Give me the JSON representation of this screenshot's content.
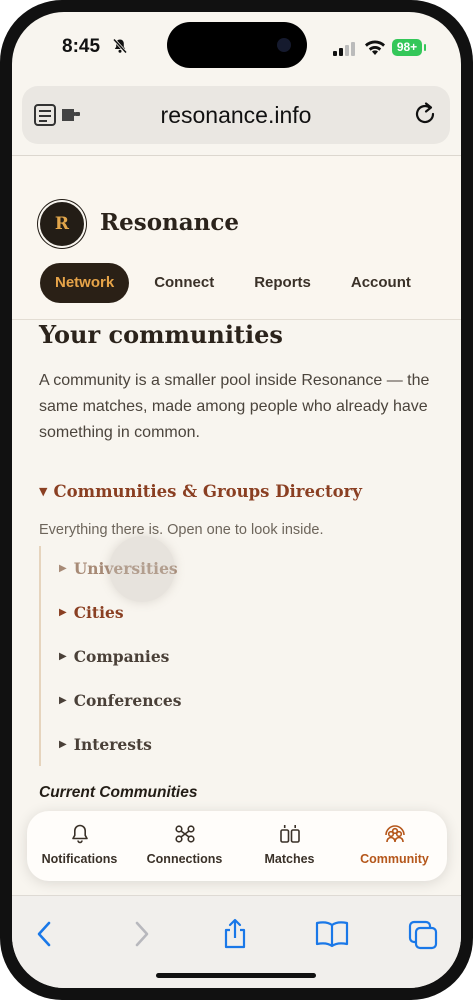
{
  "status_bar": {
    "time": "8:45",
    "battery": "98+"
  },
  "browser": {
    "url": "resonance.info"
  },
  "header": {
    "logo_letter": "R",
    "brand": "Resonance",
    "tabs": [
      "Network",
      "Connect",
      "Reports",
      "Account"
    ],
    "active_tab": "Network"
  },
  "main": {
    "title": "Your communities",
    "intro": "A community is a smaller pool inside Resonance — the same matches, made among people who already have something in common.",
    "directory": {
      "title": "Communities & Groups Directory",
      "subtitle": "Everything there is. Open one to look inside.",
      "items": [
        "Universities",
        "Cities",
        "Companies",
        "Conferences",
        "Interests"
      ]
    },
    "current_heading": "Current Communities"
  },
  "bottom_nav": {
    "items": [
      {
        "label": "Notifications",
        "icon": "bell-icon"
      },
      {
        "label": "Connections",
        "icon": "connections-icon"
      },
      {
        "label": "Matches",
        "icon": "matches-icon"
      },
      {
        "label": "Community",
        "icon": "community-icon"
      }
    ],
    "active": "Community"
  },
  "colors": {
    "accent": "#e7a449",
    "accent_dark": "#2a2016",
    "link": "#8a3f22",
    "active_nav": "#b5571b",
    "ios_blue": "#1a78e8"
  }
}
